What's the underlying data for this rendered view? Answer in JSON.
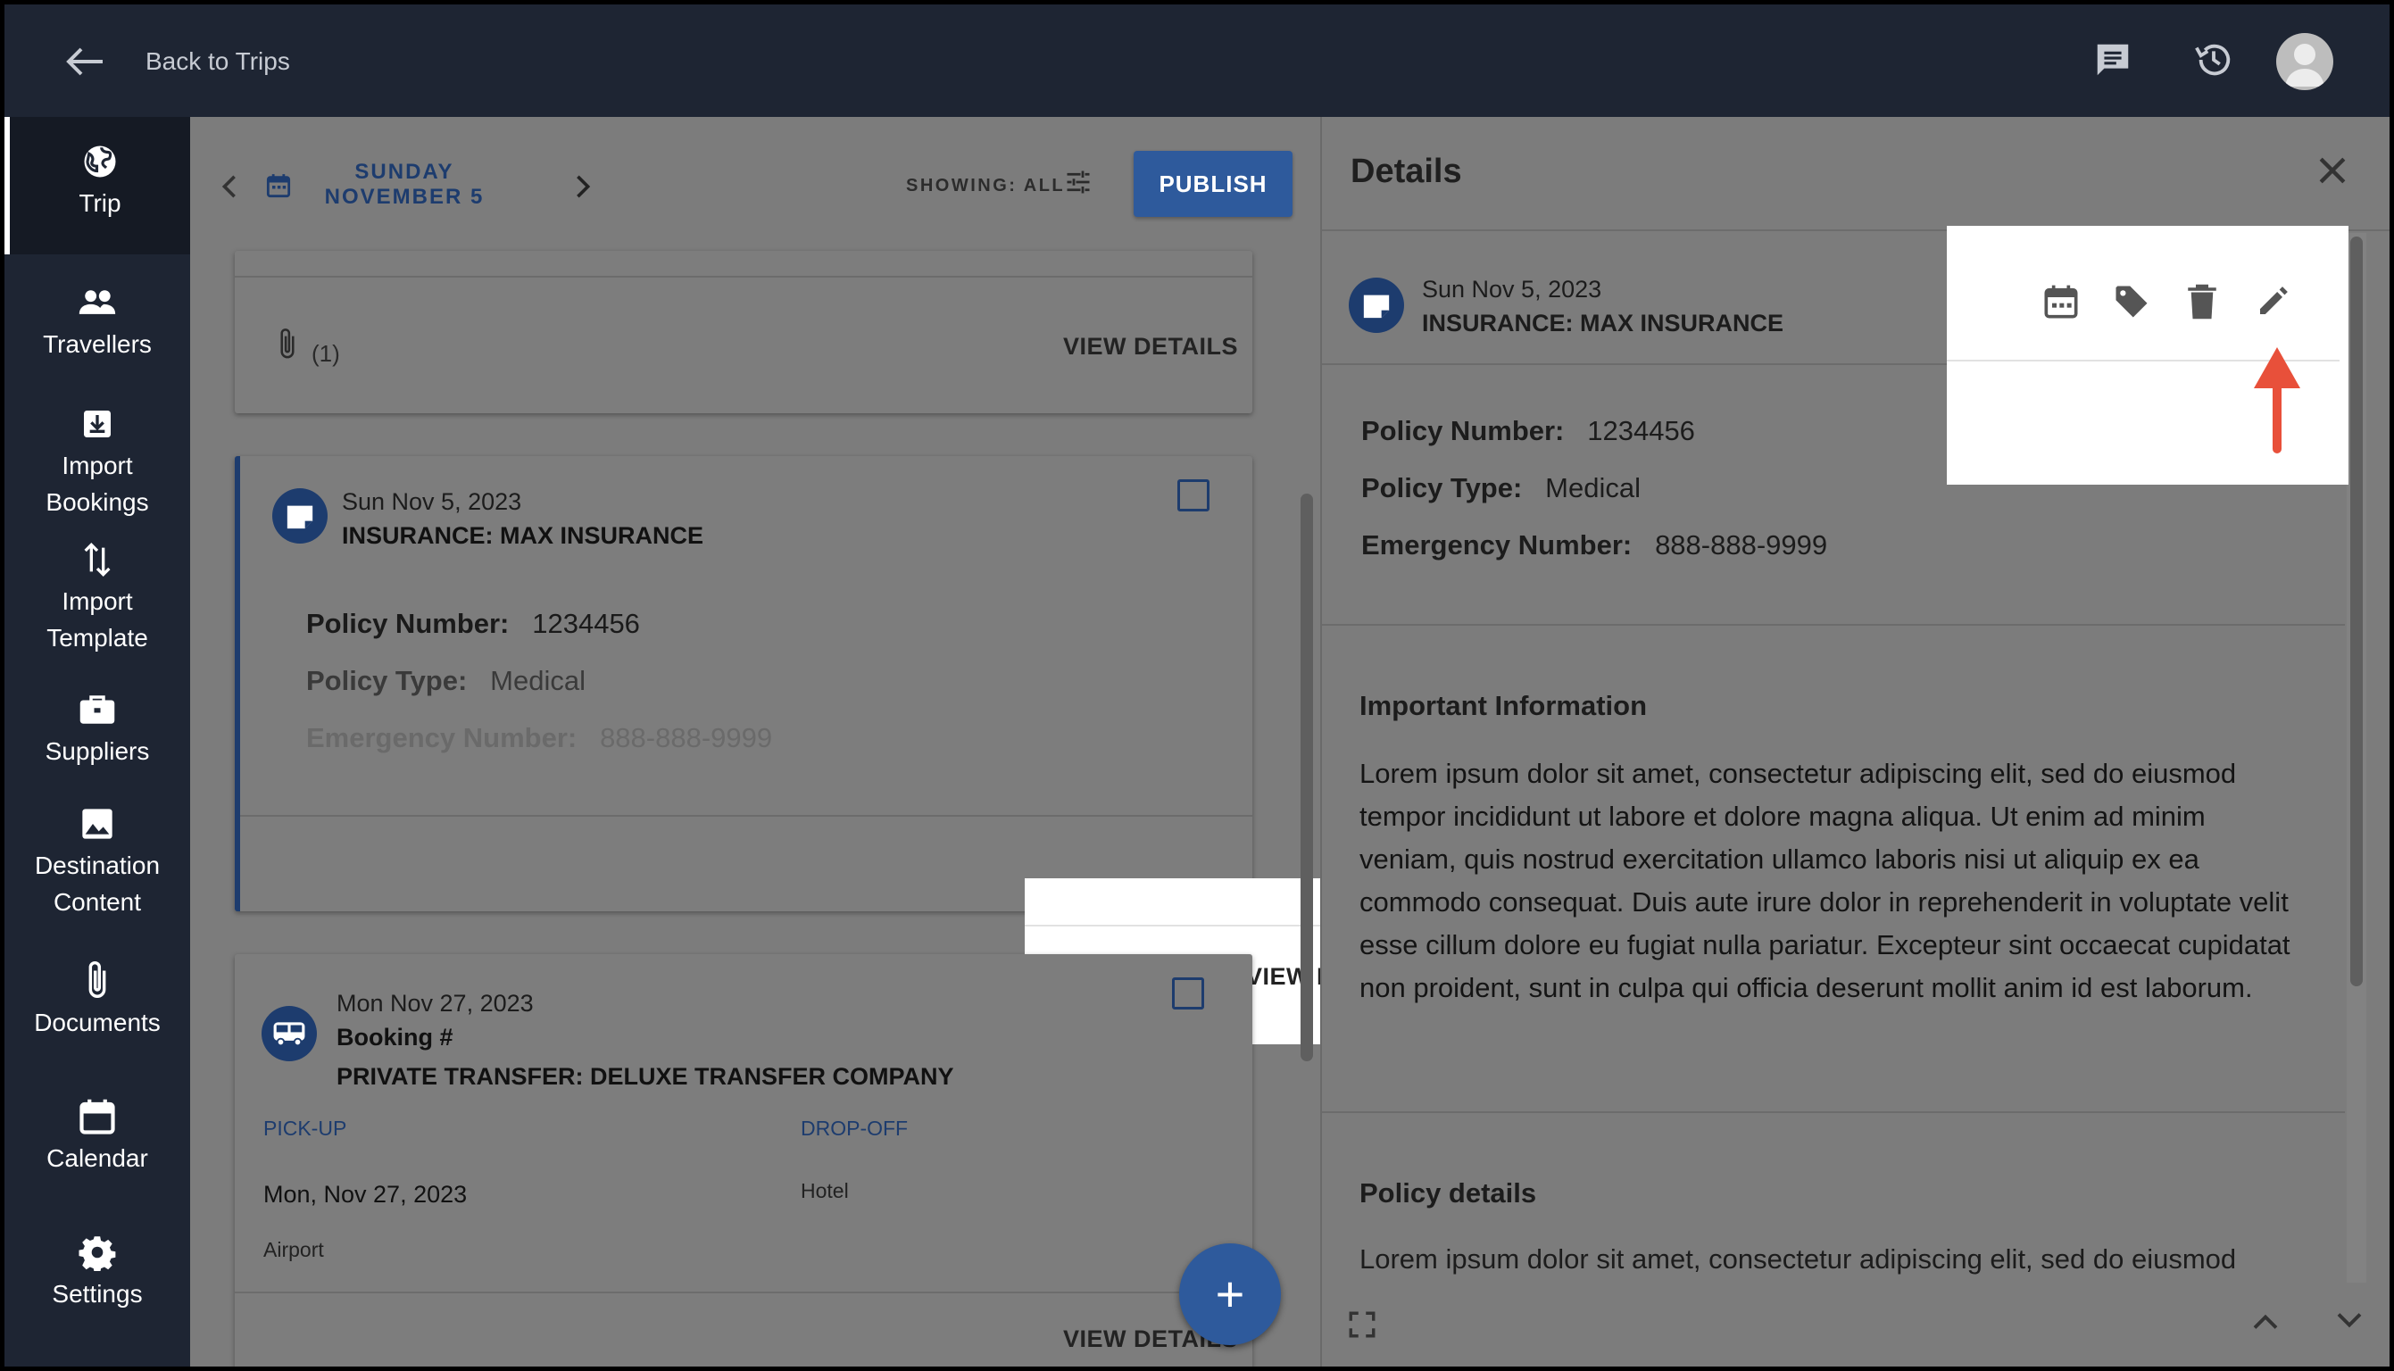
{
  "header": {
    "back_label": "Back to Trips",
    "icons": [
      "arrow-back-icon",
      "chat-icon",
      "history-icon",
      "account-icon"
    ]
  },
  "sidebar": {
    "items": [
      {
        "label": "Trip",
        "icon": "globe-icon",
        "active": true
      },
      {
        "label": "Travellers",
        "icon": "people-icon"
      },
      {
        "label": "Import Bookings",
        "icon": "import-box-icon"
      },
      {
        "label": "Import Template",
        "icon": "swap-vertical-icon"
      },
      {
        "label": "Suppliers",
        "icon": "briefcase-icon"
      },
      {
        "label": "Destination Content",
        "icon": "image-icon"
      },
      {
        "label": "Documents",
        "icon": "paperclip-icon"
      },
      {
        "label": "Calendar",
        "icon": "calendar-icon"
      },
      {
        "label": "Settings",
        "icon": "gear-icon"
      }
    ]
  },
  "main": {
    "date_title": "SUNDAY NOVEMBER 5",
    "showing": "SHOWING: ALL",
    "publish": "PUBLISH",
    "cards": [
      {
        "attachments": "(1)",
        "view_details": "VIEW DETAILS"
      },
      {
        "date": "Sun Nov 5, 2023",
        "title": "INSURANCE: MAX INSURANCE",
        "fields": [
          {
            "label": "Policy Number:",
            "value": "1234456"
          },
          {
            "label": "Policy Type:",
            "value": "Medical"
          },
          {
            "label": "Emergency Number:",
            "value": "888-888-9999"
          }
        ],
        "view_details": "VIEW DETAILS"
      },
      {
        "date": "Mon Nov 27, 2023",
        "booking": "Booking #",
        "title": "PRIVATE TRANSFER: DELUXE TRANSFER COMPANY",
        "pickup_label": "PICK-UP",
        "dropoff_label": "DROP-OFF",
        "pickup_date": "Mon, Nov 27, 2023",
        "pickup_place": "Airport",
        "dropoff_place": "Hotel",
        "view_details": "VIEW DETAILS"
      }
    ],
    "fab": "+"
  },
  "details": {
    "title": "Details",
    "date": "Sun Nov 5, 2023",
    "name": "INSURANCE: MAX INSURANCE",
    "fields": [
      {
        "label": "Policy Number:",
        "value": "1234456"
      },
      {
        "label": "Policy Type:",
        "value": "Medical"
      },
      {
        "label": "Emergency Number:",
        "value": "888-888-9999"
      }
    ],
    "important_heading": "Important Information",
    "important_text": "Lorem ipsum dolor sit amet, consectetur adipiscing elit, sed do eiusmod tempor incididunt ut labore et dolore magna aliqua. Ut enim ad minim veniam, quis nostrud exercitation ullamco laboris nisi ut aliquip ex ea commodo consequat. Duis aute irure dolor in reprehenderit in voluptate velit esse cillum dolore eu fugiat nulla pariatur. Excepteur sint occaecat cupidatat non proident, sunt in culpa qui officia deserunt mollit anim id est laborum.",
    "policy_heading": "Policy details",
    "policy_text": "Lorem ipsum dolor sit amet, consectetur adipiscing elit, sed do eiusmod",
    "actions": [
      "calendar-icon",
      "tag-icon",
      "trash-icon",
      "pencil-icon"
    ]
  },
  "colors": {
    "navy": "#1e2533",
    "brand": "#2e5a9c",
    "dark_blue": "#1d3c6e",
    "annotation_arrow": "#e8503a"
  }
}
